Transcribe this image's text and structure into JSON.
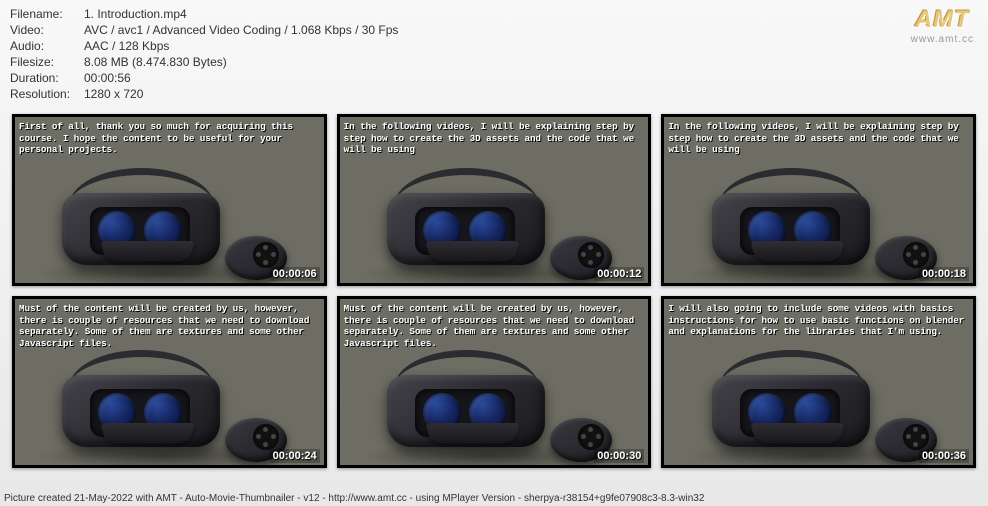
{
  "meta": {
    "filename_label": "Filename:",
    "filename_value": "1. Introduction.mp4",
    "video_label": "Video:",
    "video_value": "AVC / avc1 / Advanced Video Coding / 1.068 Kbps / 30 Fps",
    "audio_label": "Audio:",
    "audio_value": "AAC / 128 Kbps",
    "filesize_label": "Filesize:",
    "filesize_value": "8.08 MB (8.474.830 Bytes)",
    "duration_label": "Duration:",
    "duration_value": "00:00:56",
    "resolution_label": "Resolution:",
    "resolution_value": "1280 x 720"
  },
  "logo": {
    "text": "AMT",
    "url": "www.amt.cc"
  },
  "thumbs": [
    {
      "subtitle": "First of all, thank you so much for acquiring this course. I hope the content to be useful for your personal projects.",
      "timestamp": "00:00:06"
    },
    {
      "subtitle": "In the following videos, I will be explaining step by step how to create the 3D assets and the code that we will be using",
      "timestamp": "00:00:12"
    },
    {
      "subtitle": "In the following videos, I will be explaining step by step how to create the 3D assets and the code that we will be using",
      "timestamp": "00:00:18"
    },
    {
      "subtitle": "Must of the content will be created by us, however, there is couple of resources that we need to download separately. Some of them are textures and some other Javascript files.",
      "timestamp": "00:00:24"
    },
    {
      "subtitle": "Must of the content will be created by us, however, there is couple of resources that we need to download separately. Some of them are textures and some other Javascript files.",
      "timestamp": "00:00:30"
    },
    {
      "subtitle": "I will also going to include some videos with basics instructions for how to use basic functions on blender and explanations for the libraries that I'm using.",
      "timestamp": "00:00:36"
    }
  ],
  "footer": "Picture created 21-May-2022 with AMT - Auto-Movie-Thumbnailer - v12 - http://www.amt.cc - using MPlayer Version - sherpya-r38154+g9fe07908c3-8.3-win32"
}
